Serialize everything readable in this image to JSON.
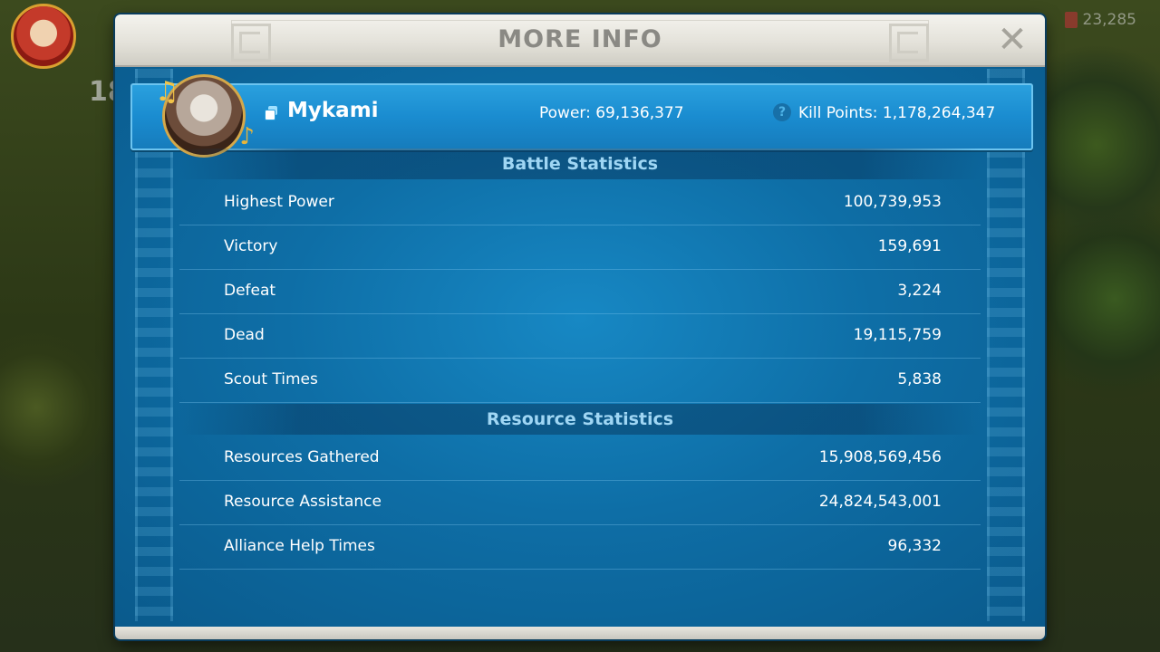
{
  "background": {
    "level": "18",
    "resource_count": "23,285"
  },
  "modal": {
    "title": "MORE INFO",
    "close_icon": "close-icon"
  },
  "player": {
    "name": "Mykami",
    "power": "Power: 69,136,377",
    "kill_points": "Kill Points: 1,178,264,347"
  },
  "battle": {
    "title": "Battle Statistics",
    "rows": [
      {
        "label": "Highest Power",
        "value": "100,739,953"
      },
      {
        "label": "Victory",
        "value": "159,691"
      },
      {
        "label": "Defeat",
        "value": "3,224"
      },
      {
        "label": "Dead",
        "value": "19,115,759"
      },
      {
        "label": "Scout Times",
        "value": "5,838"
      }
    ]
  },
  "resource": {
    "title": "Resource Statistics",
    "rows": [
      {
        "label": "Resources Gathered",
        "value": "15,908,569,456"
      },
      {
        "label": "Resource Assistance",
        "value": "24,824,543,001"
      },
      {
        "label": "Alliance Help Times",
        "value": "96,332"
      }
    ]
  },
  "colors": {
    "panel_blue": "#0f6a9e",
    "banner_blue": "#1a8cd0",
    "section_title": "#9fd6f4",
    "header_bg": "#e4e2da"
  }
}
